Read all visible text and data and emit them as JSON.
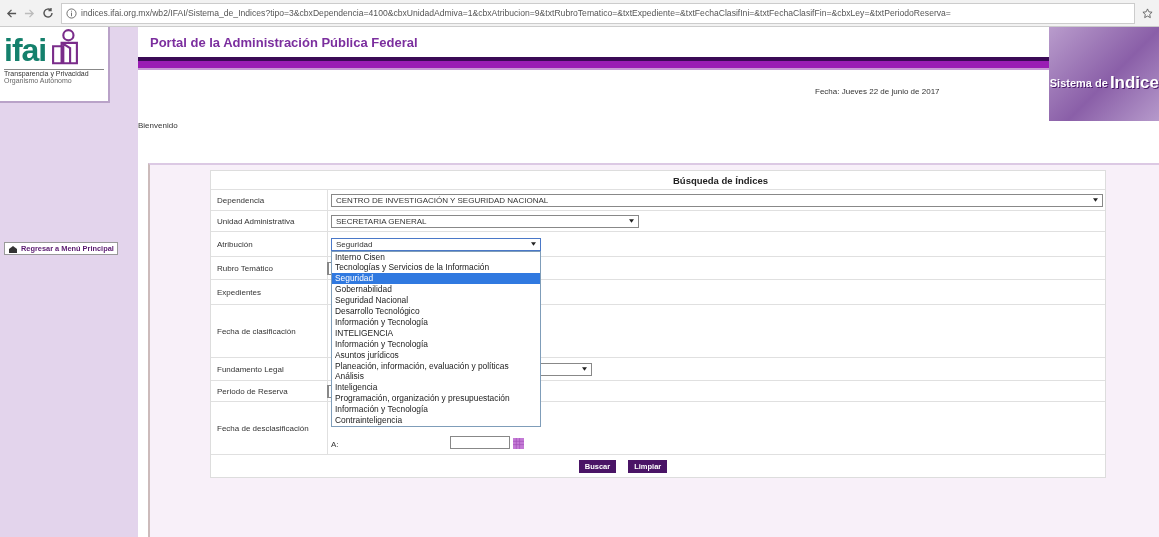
{
  "browser": {
    "url": "indices.ifai.org.mx/wb2/IFAI/Sistema_de_Indices?tipo=3&cbxDependencia=4100&cbxUnidadAdmiva=1&cbxAtribucion=9&txtRubroTematico=&txtExpediente=&txtFechaClasifIni=&txtFechaClasifFin=&cbxLey=&txtPeriodoReserva="
  },
  "header": {
    "logo": {
      "name": "ifai",
      "tagline": "Transparencia y Privacidad",
      "subtitle": "Organismo Autónomo"
    },
    "title": "Portal de la Administración Pública Federal",
    "banner": {
      "line1": "Sistema de",
      "line2": "Indice"
    },
    "date": "Fecha: Jueves 22 de junio de 2017"
  },
  "sidebar": {
    "link": "Regresar a Menú Principal"
  },
  "welcome": "Bienvenido",
  "search": {
    "title": "Búsqueda de Índices",
    "fields": [
      {
        "label": "Dependencia",
        "kind": "select",
        "value": "CENTRO DE INVESTIGACIÓN Y SEGURIDAD NACIONAL"
      },
      {
        "label": "Unidad Administrativa",
        "kind": "select",
        "value": "SECRETARIA GENERAL"
      },
      {
        "label": "Atribución",
        "kind": "select",
        "value": "Seguridad",
        "expanded": true,
        "options": [
          {
            "label": "Interno Cisen",
            "selected": false
          },
          {
            "label": "Tecnologías y Servicios de la Información",
            "selected": false
          },
          {
            "label": "Seguridad",
            "selected": true
          },
          {
            "label": "Gobernabilidad",
            "selected": false
          },
          {
            "label": "Seguridad Nacional",
            "selected": false
          },
          {
            "label": "Desarrollo Tecnológico",
            "selected": false
          },
          {
            "label": "Información y Tecnología",
            "selected": false
          },
          {
            "label": "INTELIGENCIA",
            "selected": false
          },
          {
            "label": "Información y Tecnología",
            "selected": false
          },
          {
            "label": "Asuntos jurídicos",
            "selected": false
          },
          {
            "label": "Planeación, información, evaluación y políticas",
            "selected": false
          },
          {
            "label": "Análisis",
            "selected": false
          },
          {
            "label": "Inteligencia",
            "selected": false
          },
          {
            "label": "Programación, organización y presupuestación",
            "selected": false
          },
          {
            "label": "Información y Tecnología",
            "selected": false
          },
          {
            "label": "Contrainteligencia",
            "selected": false
          }
        ]
      },
      {
        "label": "Rubro Temático",
        "kind": "text"
      },
      {
        "label": "Expedientes",
        "kind": "none"
      },
      {
        "label": "Fecha de clasificación",
        "kind": "none"
      },
      {
        "label": "Fundamento Legal",
        "kind": "select"
      },
      {
        "label": "Periodo de Reserva",
        "kind": "text"
      },
      {
        "label": "Fecha de desclasificación",
        "kind": "date_range",
        "to_label": "A:"
      }
    ],
    "buttons": [
      "Buscar",
      "Limpiar"
    ]
  }
}
